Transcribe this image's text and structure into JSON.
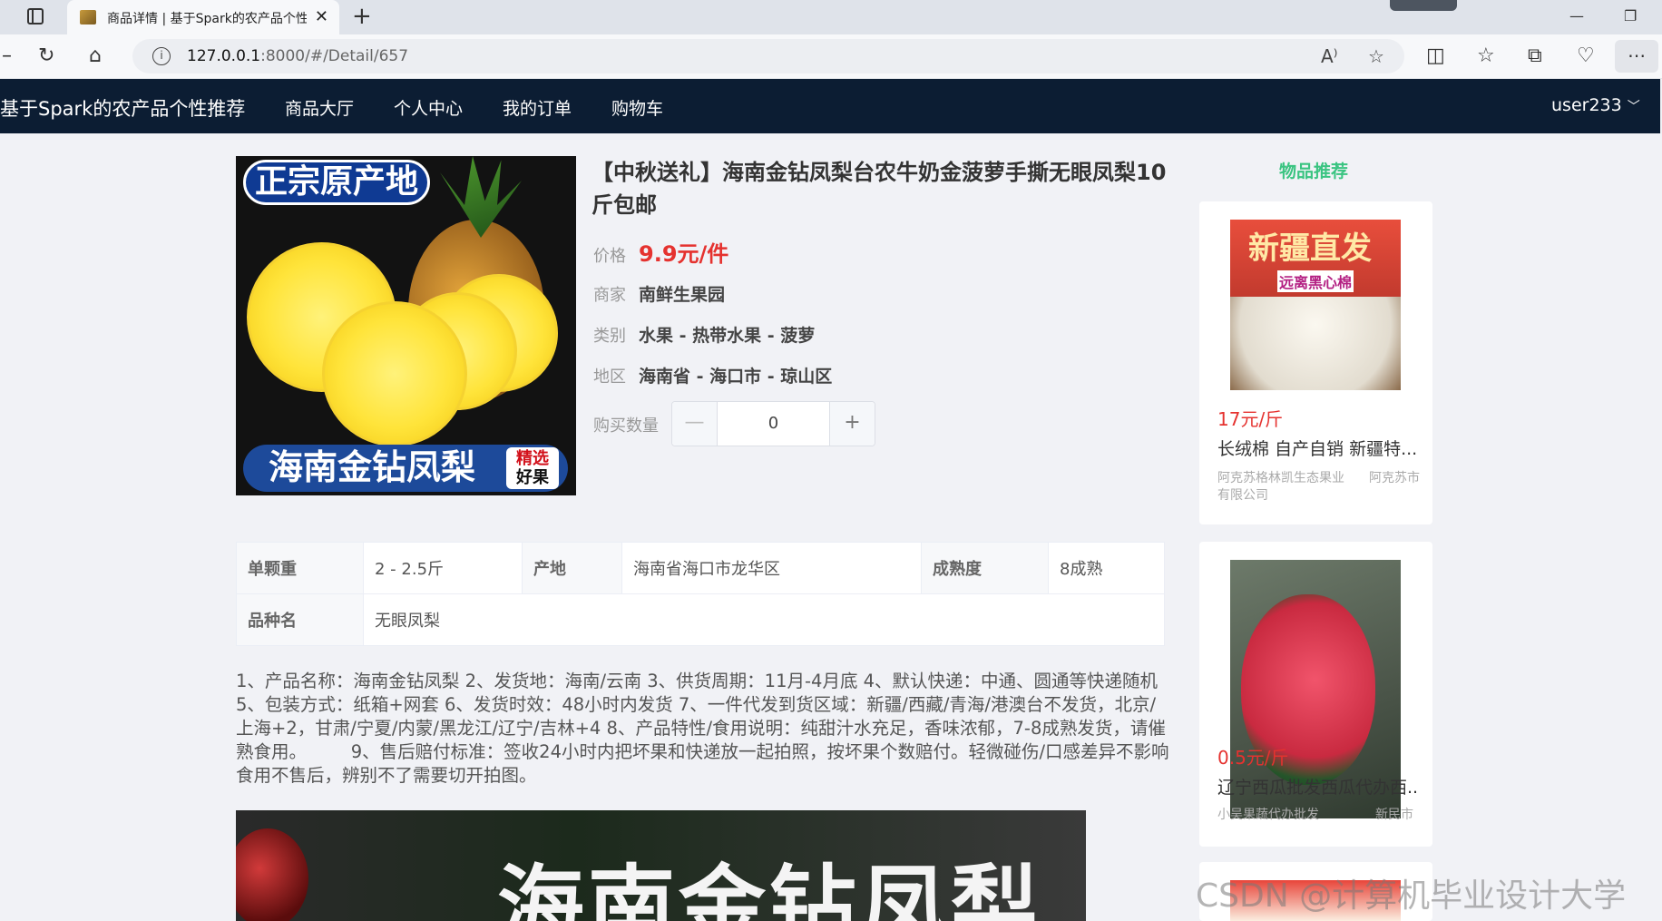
{
  "browser": {
    "tab_title": "商品详情 | 基于Spark的农产品个性化推荐",
    "url_host": "127.0.0.1",
    "url_rest": ":8000/#/Detail/657"
  },
  "nav": {
    "brand": "基于Spark的农产品个性推荐",
    "items": [
      "商品大厅",
      "个人中心",
      "我的订单",
      "购物车"
    ],
    "user": "user233"
  },
  "product": {
    "image_badge_top": "正宗原产地",
    "image_badge_bottom": "海南金钻凤梨",
    "image_tag_1": "精选",
    "image_tag_2": "好果",
    "title": "【中秋送礼】海南金钻凤梨台农牛奶金菠萝手撕无眼凤梨10斤包邮",
    "price_label": "价格",
    "price": "9.9元/件",
    "merchant_label": "商家",
    "merchant": "南鲜生果园",
    "category_label": "类别",
    "category": "水果 - 热带水果 - 菠萝",
    "region_label": "地区",
    "region": "海南省 - 海口市 - 琼山区",
    "qty_label": "购买数量",
    "qty": "0"
  },
  "attributes": {
    "weight_k": "单颗重",
    "weight_v": "2 - 2.5斤",
    "origin_k": "产地",
    "origin_v": "海南省海口市龙华区",
    "ripeness_k": "成熟度",
    "ripeness_v": "8成熟",
    "variety_k": "品种名",
    "variety_v": "无眼凤梨"
  },
  "description": "1、产品名称：海南金钻凤梨 2、发货地：海南/云南 3、供货周期：11月-4月底 4、默认快递：中通、圆通等快递随机 5、包装方式：纸箱+网套 6、发货时效：48小时内发货 7、一件代发到货区域：新疆/西藏/青海/港澳台不发货，北京/上海+2，甘肃/宁夏/内蒙/黑龙江/辽宁/吉林+4 8、产品特性/食用说明：纯甜汁水充足，香味浓郁，7-8成熟发货，请催熟食用。　　　9、售后赔付标准：签收24小时内把坏果和快递放一起拍照，按坏果个数赔付。轻微碰伤/口感差异不影响食用不售后，辨别不了需要切开拍图。",
  "banner_text": "海南金钻凤梨",
  "recommend": {
    "title": "物品推荐",
    "items": [
      {
        "img_text": "新疆直发",
        "img_sub": "远离黑心棉",
        "price": "17元/斤",
        "name": "长绒棉 自产自销 新疆特...",
        "shop": "阿克苏格林凯生态果业有限公司",
        "area": "阿克苏市"
      },
      {
        "price": "0.5元/斤",
        "name": "辽宁西瓜批发西瓜代办西...",
        "shop": "小吴果蔬代办批发",
        "area": "新民市"
      }
    ]
  },
  "watermark": "CSDN @计算机毕业设计大学"
}
